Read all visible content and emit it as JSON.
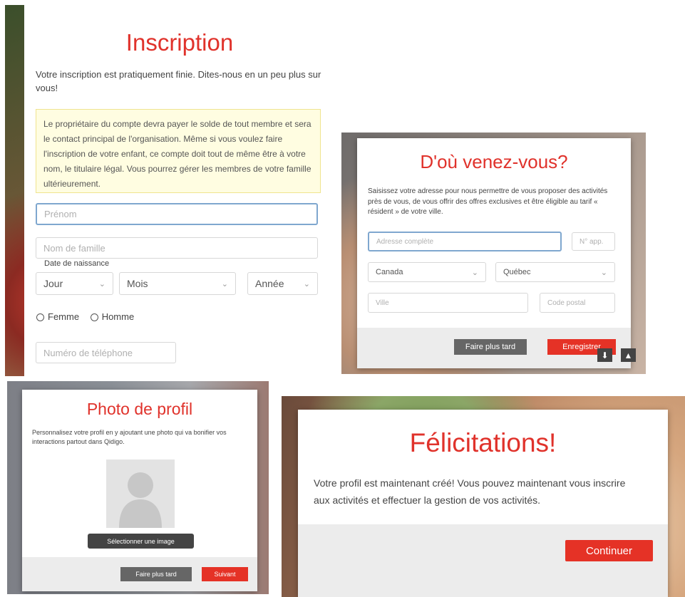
{
  "inscription": {
    "title": "Inscription",
    "intro": "Votre inscription est pratiquement finie. Dites-nous en un peu plus sur vous!",
    "notice": "Le propriétaire du compte devra payer le solde de tout membre et sera le contact principal de l'organisation. Même si vous voulez faire l'inscription de votre enfant, ce compte doit tout de même être à votre nom, le titulaire légal. Vous pourrez gérer les membres de votre famille ultérieurement.",
    "first_name_placeholder": "Prénom",
    "last_name_placeholder": "Nom de famille",
    "dob_label": "Date de naissance",
    "day_value": "Jour",
    "month_value": "Mois",
    "year_value": "Année",
    "gender_female": "Femme",
    "gender_male": "Homme",
    "phone_placeholder": "Numéro de téléphone"
  },
  "address": {
    "title": "D'où venez-vous?",
    "intro": "Saisissez votre adresse pour nous permettre de vous proposer des activités près de vous, de vous offrir des offres exclusives et être éligible au tarif « résident » de votre ville.",
    "address_placeholder": "Adresse complète",
    "apt_placeholder": "N° app.",
    "country_value": "Canada",
    "province_value": "Québec",
    "city_placeholder": "Ville",
    "postal_placeholder": "Code postal",
    "later_label": "Faire plus tard",
    "save_label": "Enregistrer"
  },
  "photo": {
    "title": "Photo de profil",
    "intro": "Personnalisez votre profil en y ajoutant une photo qui va bonifier vos interactions partout dans Qidigo.",
    "select_label": "Sélectionner une image",
    "later_label": "Faire plus tard",
    "next_label": "Suivant"
  },
  "congrats": {
    "title": "Félicitations!",
    "message": "Votre profil est maintenant créé! Vous pouvez maintenant vous inscrire aux activités et effectuer la gestion de vos activités.",
    "continue_label": "Continuer"
  },
  "icons": {
    "download": "download-icon",
    "drive": "google-drive-icon"
  },
  "colors": {
    "accent": "#e0322b",
    "button_red": "#e53226",
    "button_grey": "#666666",
    "notice_bg": "#fffde1"
  }
}
